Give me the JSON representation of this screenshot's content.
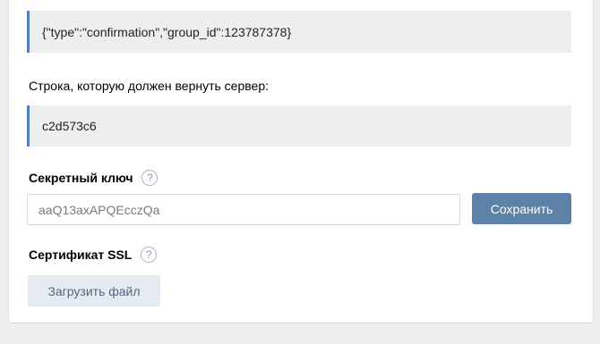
{
  "confirmation": {
    "request_json": "{\"type\":\"confirmation\",\"group_id\":123787378}",
    "response_label": "Строка, которую должен вернуть сервер:",
    "response_value": "c2d573c6"
  },
  "secret_key": {
    "label": "Секретный ключ",
    "help_glyph": "?",
    "value": "aaQ13axAPQEcczQa",
    "save_label": "Сохранить"
  },
  "ssl": {
    "label": "Сертификат SSL",
    "help_glyph": "?",
    "upload_label": "Загрузить файл"
  },
  "colors": {
    "page_bg": "#edeef0",
    "accent": "#5181b8",
    "primary_button": "#5e81a8",
    "secondary_button": "#e5ebf1"
  }
}
